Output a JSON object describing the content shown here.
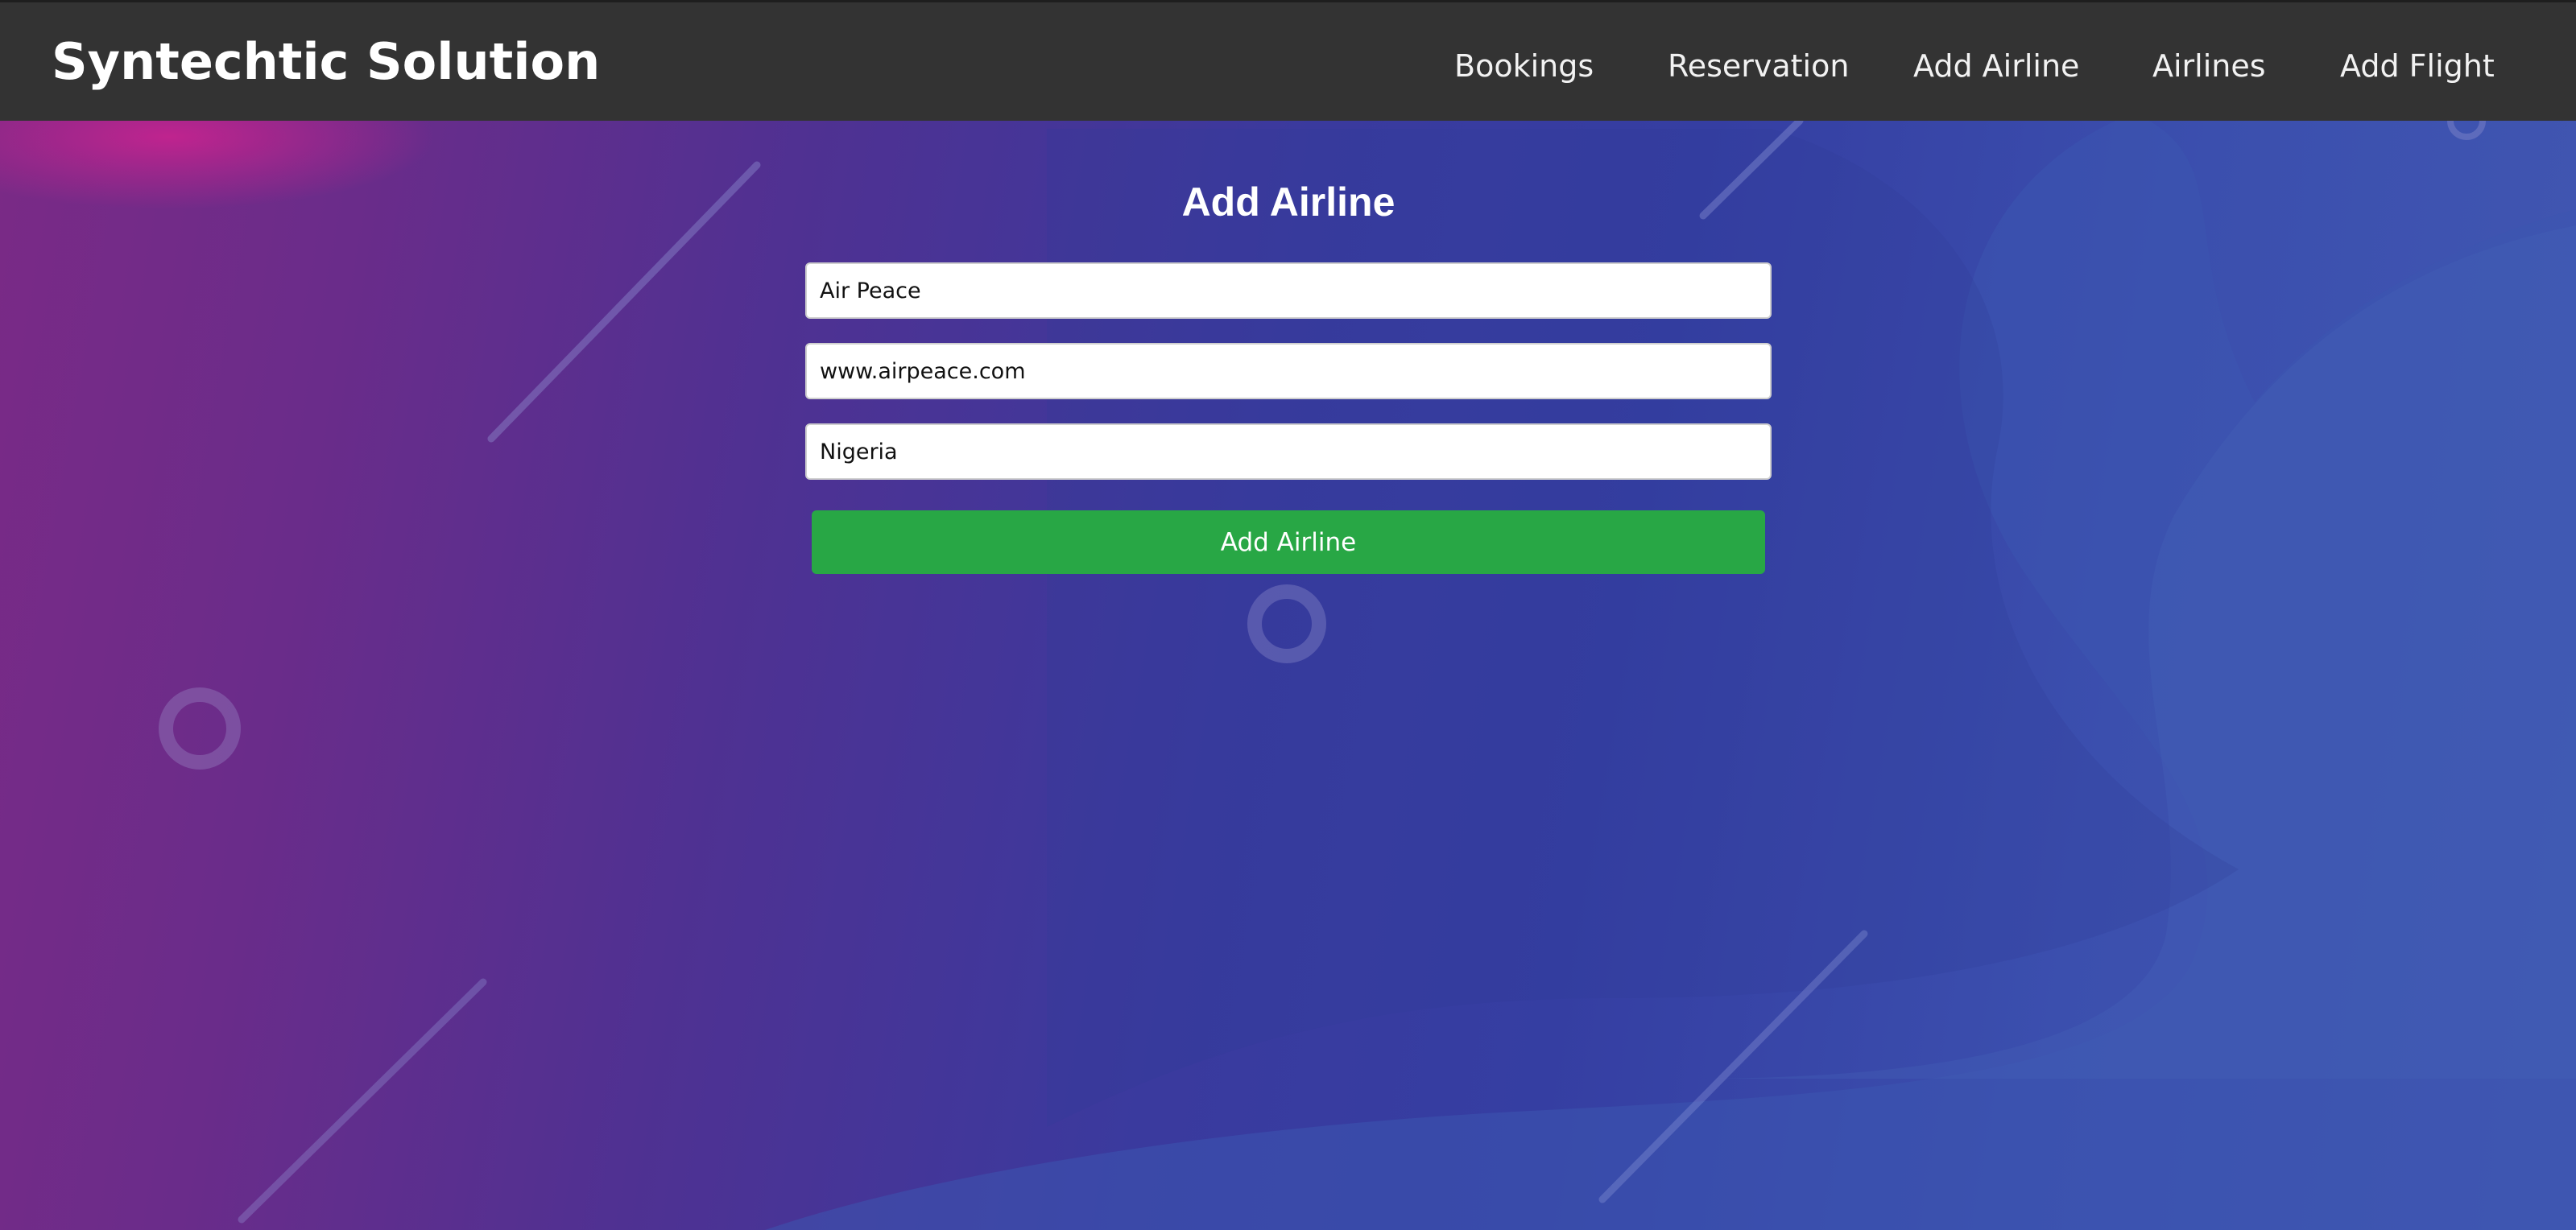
{
  "brand": {
    "title": "Syntechtic Solution"
  },
  "nav": {
    "items": [
      {
        "label": "Bookings"
      },
      {
        "label": "Reservation"
      },
      {
        "label": "Add Airline"
      },
      {
        "label": "Airlines"
      },
      {
        "label": "Add Flight"
      }
    ]
  },
  "form": {
    "title": "Add Airline",
    "fields": {
      "name": {
        "value": "Air Peace"
      },
      "website": {
        "value": "www.airpeace.com"
      },
      "country": {
        "value": "Nigeria"
      }
    },
    "submit_label": "Add Airline"
  },
  "colors": {
    "navbar": "#333333",
    "submit": "#28a745",
    "background_start": "#7b2a86",
    "background_end": "#4258b2"
  }
}
